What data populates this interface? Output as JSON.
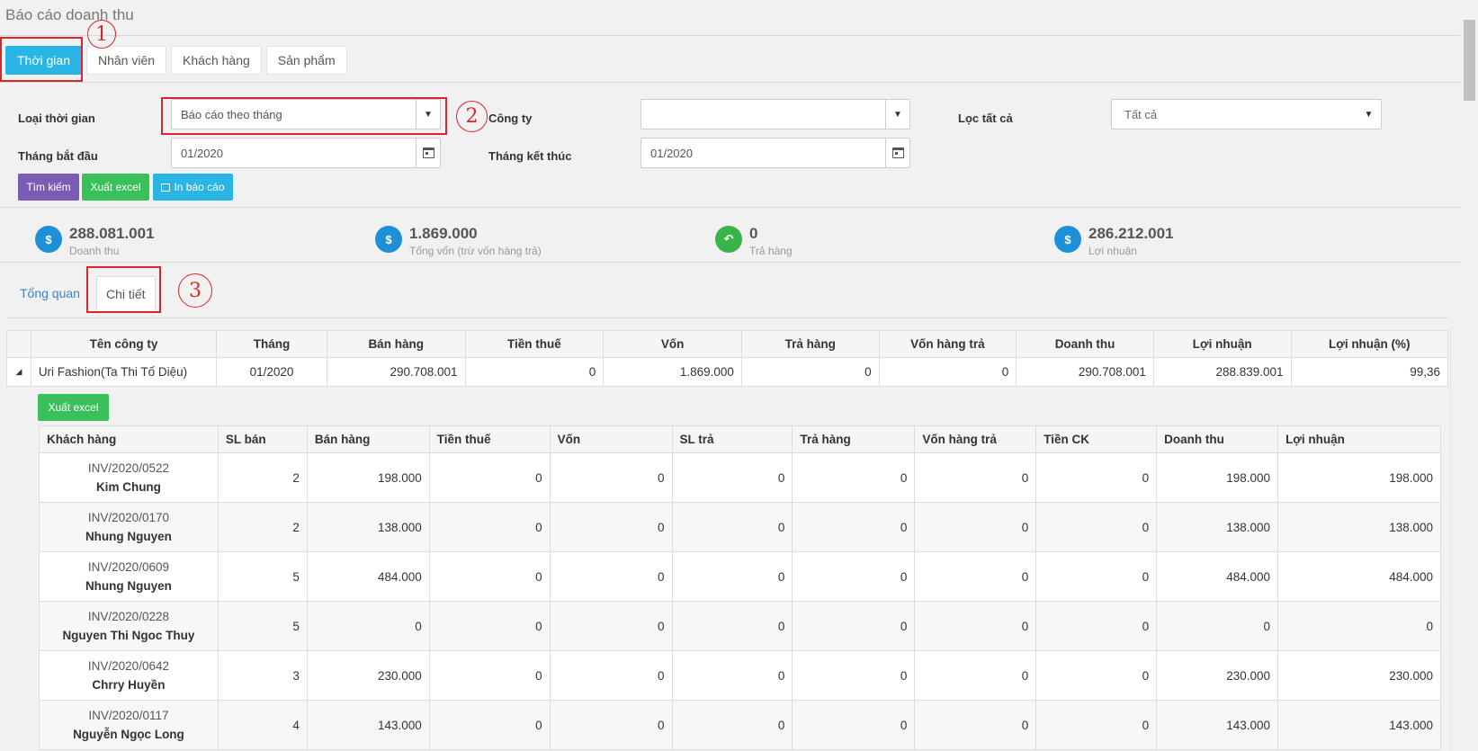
{
  "page_title": "Báo cáo doanh thu",
  "top_tabs": [
    {
      "label": "Thời gian",
      "active": true
    },
    {
      "label": "Nhân viên",
      "active": false
    },
    {
      "label": "Khách hàng",
      "active": false
    },
    {
      "label": "Sản phẩm",
      "active": false
    }
  ],
  "annotations": [
    "1",
    "2",
    "3"
  ],
  "filters": {
    "time_type_label": "Loại thời gian",
    "time_type_value": "Báo cáo theo tháng",
    "company_label": "Công ty",
    "company_value": "",
    "filter_all_label": "Lọc tất cả",
    "filter_all_value": "Tất cả",
    "start_month_label": "Tháng bắt đầu",
    "start_month_value": "01/2020",
    "end_month_label": "Tháng kết thúc",
    "end_month_value": "01/2020"
  },
  "actions": {
    "search_label": "Tìm kiếm",
    "export_label": "Xuất excel",
    "print_label": "In báo cáo"
  },
  "stats": [
    {
      "value": "288.081.001",
      "label": "Doanh thu",
      "icon": "dollar-icon",
      "color": "#1e90d8"
    },
    {
      "value": "1.869.000",
      "label": "Tổng vốn (trừ vốn hàng trả)",
      "icon": "dollar-icon",
      "color": "#1e90d8"
    },
    {
      "value": "0",
      "label": "Trả hàng",
      "icon": "return-icon",
      "color": "#38b44a"
    },
    {
      "value": "286.212.001",
      "label": "Lợi nhuận",
      "icon": "dollar-icon",
      "color": "#1e90d8"
    }
  ],
  "sub_tabs": [
    {
      "label": "Tổng quan",
      "active": false
    },
    {
      "label": "Chi tiết",
      "active": true
    }
  ],
  "main_table": {
    "columns": [
      "Tên công ty",
      "Tháng",
      "Bán hàng",
      "Tiền thuế",
      "Vốn",
      "Trả hàng",
      "Vốn hàng trả",
      "Doanh thu",
      "Lợi nhuận",
      "Lợi nhuận (%)"
    ],
    "rows": [
      [
        "Uri Fashion(Ta Thi Tố Diệu)",
        "01/2020",
        "290.708.001",
        "0",
        "1.869.000",
        "0",
        "0",
        "290.708.001",
        "288.839.001",
        "99,36"
      ]
    ]
  },
  "detail": {
    "export_label": "Xuất excel",
    "columns": [
      "Khách hàng",
      "SL bán",
      "Bán hàng",
      "Tiền thuế",
      "Vốn",
      "SL trả",
      "Trả hàng",
      "Vốn hàng trả",
      "Tiền CK",
      "Doanh thu",
      "Lợi nhuận"
    ],
    "rows": [
      {
        "invoice": "INV/2020/0522",
        "customer": "Kim Chung",
        "values": [
          "2",
          "198.000",
          "0",
          "0",
          "0",
          "0",
          "0",
          "0",
          "198.000",
          "198.000"
        ]
      },
      {
        "invoice": "INV/2020/0170",
        "customer": "Nhung Nguyen",
        "values": [
          "2",
          "138.000",
          "0",
          "0",
          "0",
          "0",
          "0",
          "0",
          "138.000",
          "138.000"
        ]
      },
      {
        "invoice": "INV/2020/0609",
        "customer": "Nhung Nguyen",
        "values": [
          "5",
          "484.000",
          "0",
          "0",
          "0",
          "0",
          "0",
          "0",
          "484.000",
          "484.000"
        ]
      },
      {
        "invoice": "INV/2020/0228",
        "customer": "Nguyen Thi Ngoc Thuy",
        "values": [
          "5",
          "0",
          "0",
          "0",
          "0",
          "0",
          "0",
          "0",
          "0",
          "0"
        ]
      },
      {
        "invoice": "INV/2020/0642",
        "customer": "Chrry Huyền",
        "values": [
          "3",
          "230.000",
          "0",
          "0",
          "0",
          "0",
          "0",
          "0",
          "230.000",
          "230.000"
        ]
      },
      {
        "invoice": "INV/2020/0117",
        "customer": "Nguyễn Ngọc Long",
        "values": [
          "4",
          "143.000",
          "0",
          "0",
          "0",
          "0",
          "0",
          "0",
          "143.000",
          "143.000"
        ]
      }
    ]
  }
}
